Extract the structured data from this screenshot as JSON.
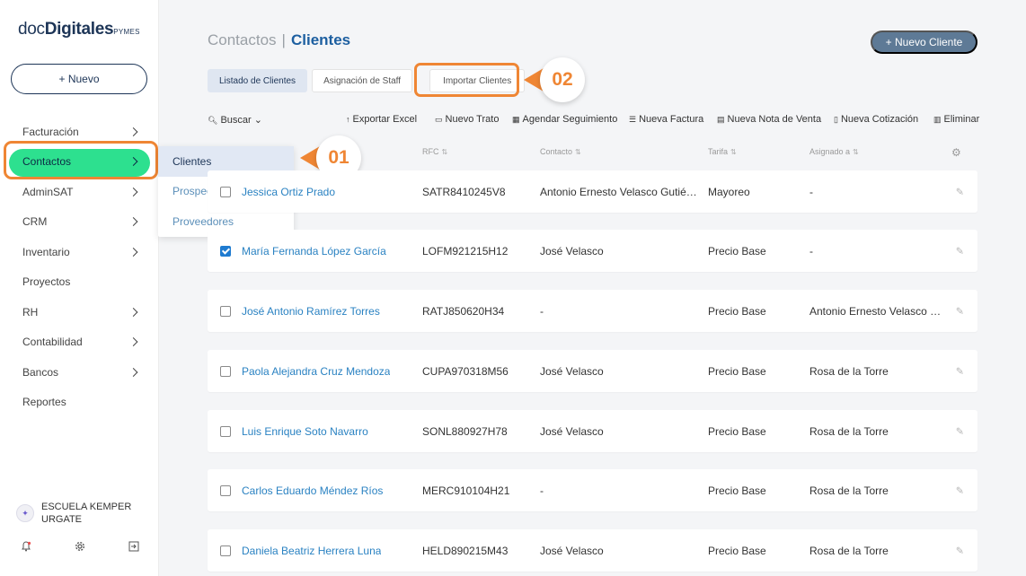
{
  "sidebar": {
    "logo_doc": "doc",
    "logo_digitales": "Digitales",
    "logo_pymes": "PYMES",
    "new_button": "+ Nuevo",
    "items": [
      {
        "label": "Facturación",
        "chevron": true
      },
      {
        "label": "Contactos",
        "chevron": true
      },
      {
        "label": "AdminSAT",
        "chevron": true
      },
      {
        "label": "CRM",
        "chevron": true
      },
      {
        "label": "Inventario",
        "chevron": true
      },
      {
        "label": "Proyectos",
        "chevron": false
      },
      {
        "label": "RH",
        "chevron": true
      },
      {
        "label": "Contabilidad",
        "chevron": true
      },
      {
        "label": "Bancos",
        "chevron": true
      },
      {
        "label": "Reportes",
        "chevron": false
      }
    ],
    "org_name": "ESCUELA KEMPER URGATE",
    "bottom_icons": [
      "notification-icon",
      "settings-icon",
      "logout-icon"
    ]
  },
  "submenu": {
    "items": [
      {
        "label": "Clientes"
      },
      {
        "label": "Prospectos"
      },
      {
        "label": "Proveedores"
      }
    ]
  },
  "markers": {
    "m1": "01",
    "m2": "02"
  },
  "header": {
    "breadcrumb_parent": "Contactos",
    "breadcrumb_sep": "|",
    "breadcrumb_current": "Clientes",
    "new_client_button": "+ Nuevo Cliente"
  },
  "tabs": {
    "list": "Listado de Clientes",
    "staff": "Asignación de Staff",
    "import": "Importar Clientes"
  },
  "toolbar": {
    "search": "Buscar",
    "export": "Exportar Excel",
    "new_deal": "Nuevo Trato",
    "schedule": "Agendar Seguimiento",
    "new_invoice": "Nueva Factura",
    "new_sale_note": "Nueva Nota de Venta",
    "new_quote": "Nueva Cotización",
    "delete": "Eliminar"
  },
  "table": {
    "headers": {
      "rfc": "RFC",
      "contact": "Contacto",
      "tarifa": "Tarifa",
      "assigned": "Asignado a"
    },
    "rows": [
      {
        "name": "Jessica Ortiz Prado",
        "rfc": "SATR8410245V8",
        "contact": "Antonio Ernesto Velasco Gutiérrez",
        "tarifa": "Mayoreo",
        "assigned": "-",
        "checked": false
      },
      {
        "name": "María Fernanda López García",
        "rfc": "LOFM921215H12",
        "contact": "José Velasco",
        "tarifa": "Precio Base",
        "assigned": "-",
        "checked": true
      },
      {
        "name": "José Antonio Ramírez Torres",
        "rfc": "RATJ850620H34",
        "contact": "-",
        "tarifa": "Precio Base",
        "assigned": "Antonio Ernesto Velasco Gutiérrez",
        "checked": false
      },
      {
        "name": "Paola Alejandra Cruz Mendoza",
        "rfc": "CUPA970318M56",
        "contact": "José Velasco",
        "tarifa": "Precio Base",
        "assigned": "Rosa de la Torre",
        "checked": false
      },
      {
        "name": "Luis Enrique Soto Navarro",
        "rfc": "SONL880927H78",
        "contact": "José Velasco",
        "tarifa": "Precio Base",
        "assigned": "Rosa de la Torre",
        "checked": false
      },
      {
        "name": "Carlos Eduardo Méndez Ríos",
        "rfc": "MERC910104H21",
        "contact": "-",
        "tarifa": "Precio Base",
        "assigned": "Rosa de la Torre",
        "checked": false
      },
      {
        "name": "Daniela Beatriz Herrera Luna",
        "rfc": "HELD890215M43",
        "contact": "José Velasco",
        "tarifa": "Precio Base",
        "assigned": "Rosa de la Torre",
        "checked": false
      }
    ]
  },
  "colors": {
    "accent_green": "#2de08f",
    "callout_orange": "#ef8634",
    "link_blue": "#2a82c2",
    "primary_navy": "#1d3557"
  }
}
